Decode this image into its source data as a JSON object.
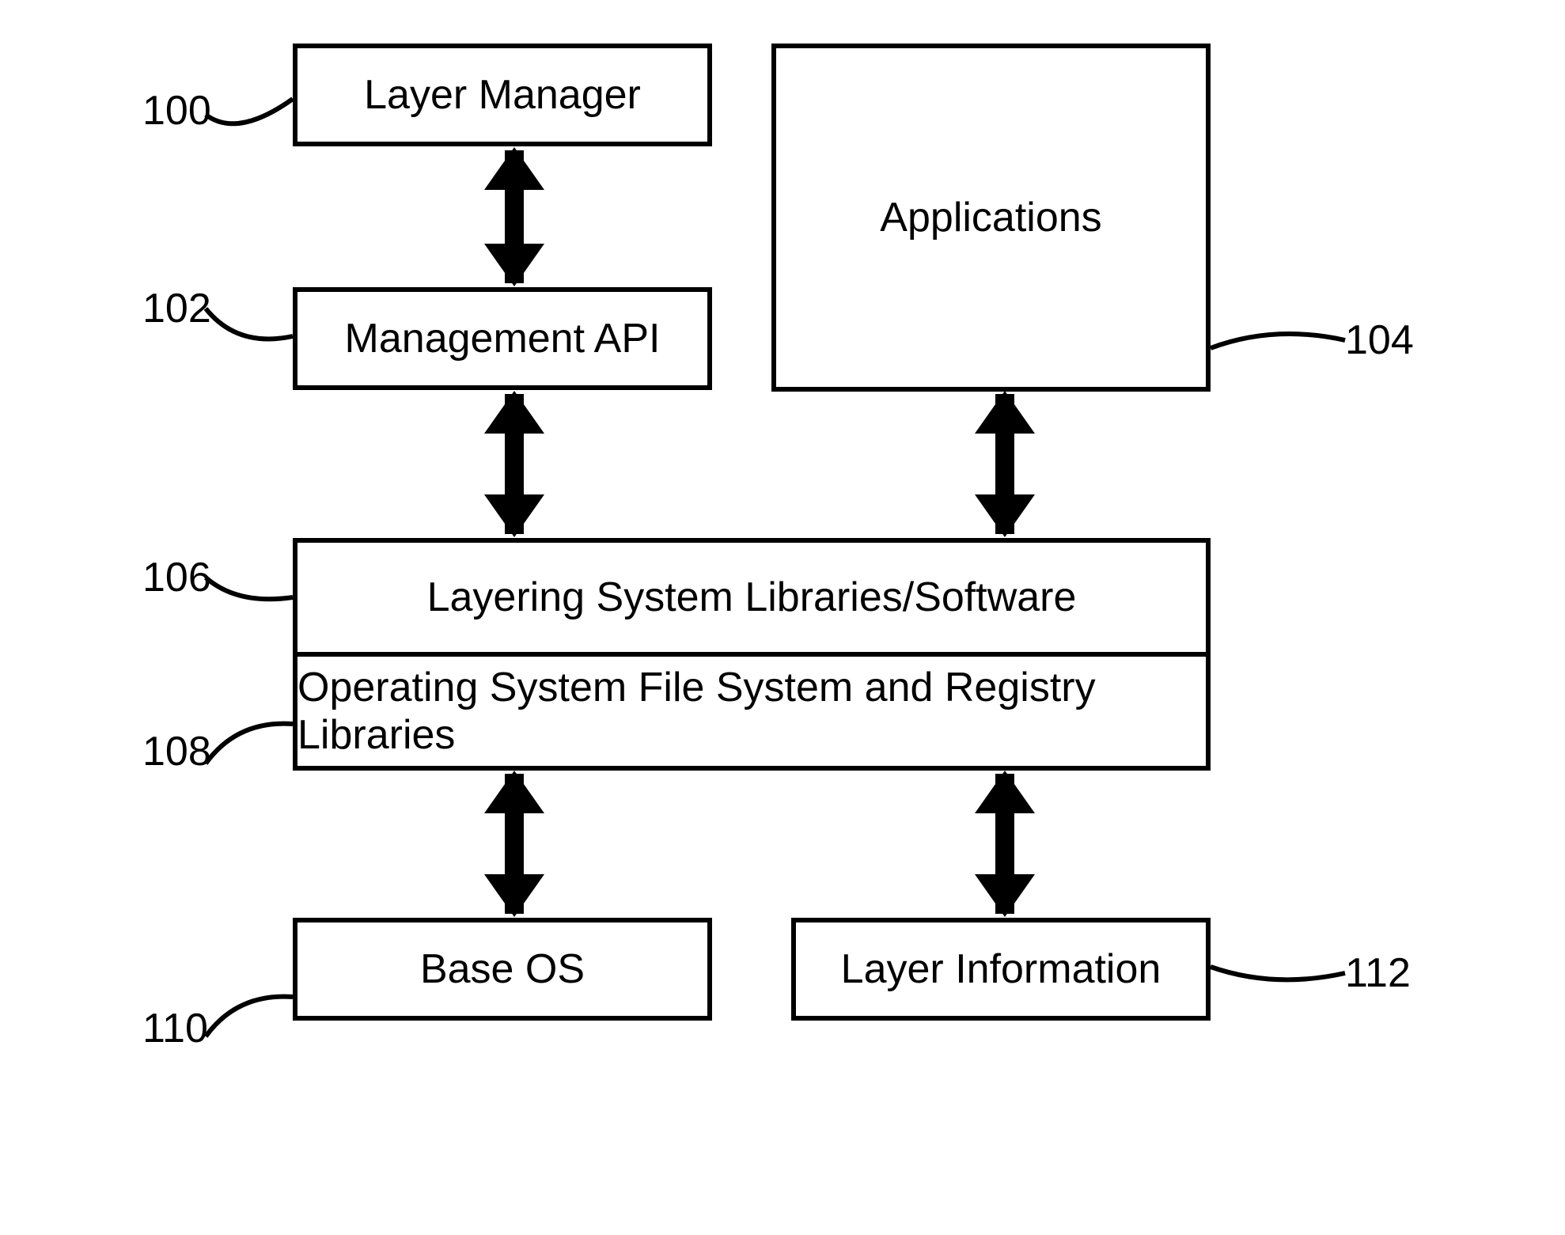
{
  "boxes": {
    "layer_manager": "Layer Manager",
    "management_api": "Management API",
    "applications": "Applications",
    "layering_libs": "Layering System Libraries/Software",
    "os_fs_registry": "Operating System File System and Registry Libraries",
    "base_os": "Base OS",
    "layer_information": "Layer Information"
  },
  "labels": {
    "l100": "100",
    "l102": "102",
    "l104": "104",
    "l106": "106",
    "l108": "108",
    "l110": "110",
    "l112": "112"
  }
}
